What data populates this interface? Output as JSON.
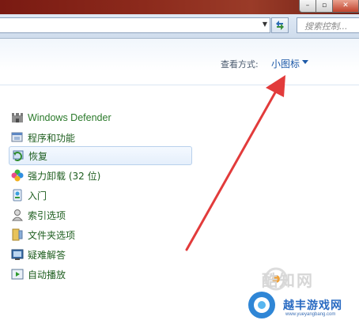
{
  "toolbar": {
    "search_placeholder": "搜索控制..."
  },
  "view": {
    "label": "查看方式:",
    "value": "小图标"
  },
  "items": [
    {
      "label": "Windows Defender",
      "icon": "castle-icon"
    },
    {
      "label": "程序和功能",
      "icon": "programs-icon"
    },
    {
      "label": "恢复",
      "icon": "recovery-icon",
      "selected": true
    },
    {
      "label": "强力卸载 (32 位)",
      "icon": "clover-icon"
    },
    {
      "label": "入门",
      "icon": "getting-started-icon"
    },
    {
      "label": "索引选项",
      "icon": "indexing-icon"
    },
    {
      "label": "文件夹选项",
      "icon": "folder-options-icon"
    },
    {
      "label": "疑难解答",
      "icon": "troubleshooting-icon"
    },
    {
      "label": "自动播放",
      "icon": "autoplay-icon"
    }
  ],
  "watermarks": {
    "primary": "酷知网",
    "secondary": "越丰游戏网",
    "url": "www.yueyangbang.com"
  },
  "colors": {
    "item_text": "#1e5e1f",
    "link": "#1e5aa8",
    "annotation_arrow": "#e23b3b"
  }
}
